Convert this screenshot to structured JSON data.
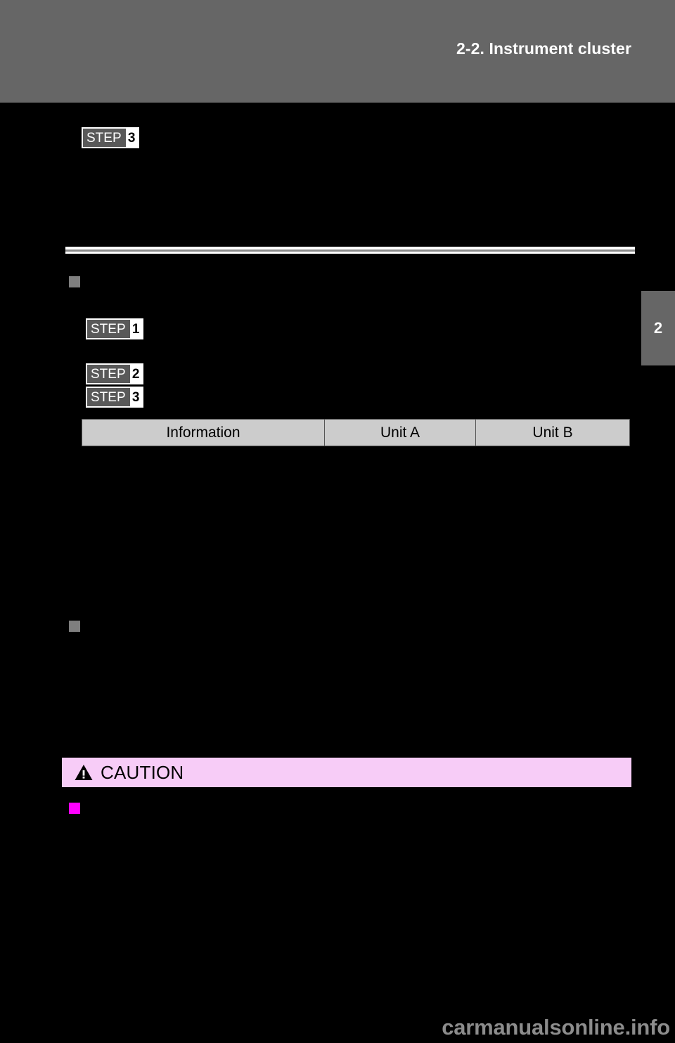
{
  "header": {
    "section_title": "2-2. Instrument cluster",
    "band_color": "#666666"
  },
  "chapter_tab": {
    "number": "2",
    "color": "#666666"
  },
  "steps": {
    "top": {
      "word": "STEP",
      "number": "3"
    },
    "s1": {
      "word": "STEP",
      "number": "1"
    },
    "s2": {
      "word": "STEP",
      "number": "2"
    },
    "s3": {
      "word": "STEP",
      "number": "3"
    }
  },
  "table": {
    "headers": [
      "Information",
      "Unit A",
      "Unit B"
    ],
    "rows": [],
    "header_bg": "#cccccc"
  },
  "caution": {
    "label": "CAUTION",
    "icon": "warning-triangle-icon",
    "banner_color": "#f7ccf7",
    "bullet_color": "#ff00ff"
  },
  "bullets": {
    "section_marker_color": "#7f7f7f"
  },
  "footer": {
    "watermark": "carmanualsonline.info"
  }
}
